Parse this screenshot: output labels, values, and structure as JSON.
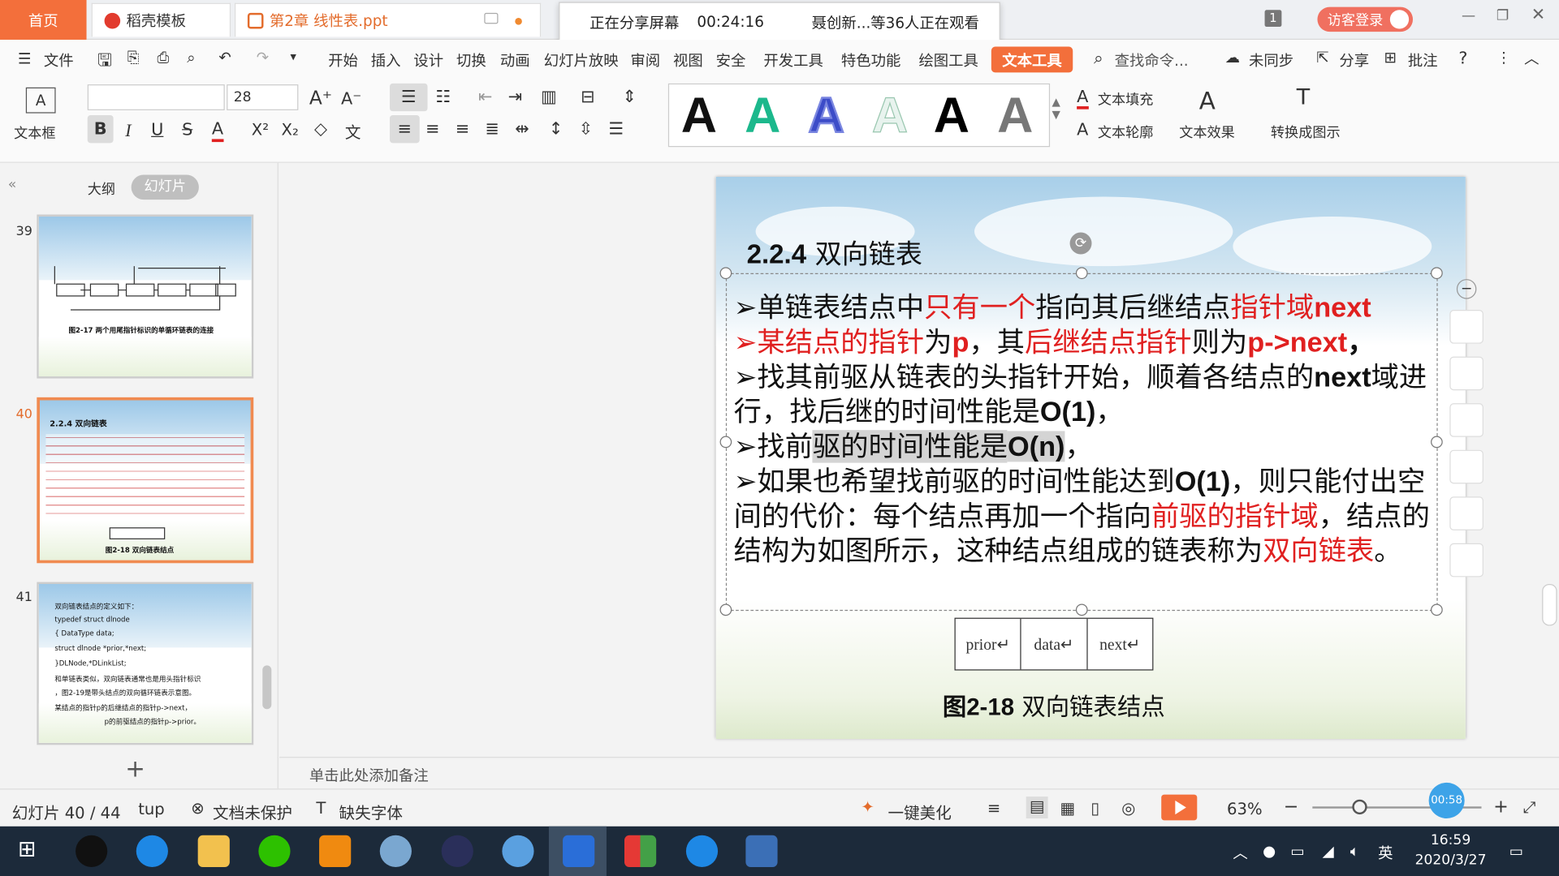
{
  "tabs": {
    "home": "首页",
    "template": "稻壳模板",
    "document": "第2章 线性表.ppt"
  },
  "share_banner": {
    "status": "正在分享屏幕",
    "time": "00:24:16",
    "viewers": "聂创新...等36人正在观看"
  },
  "titlebar": {
    "badge": "1",
    "visitor_login": "访客登录"
  },
  "menu": {
    "file": "文件",
    "items": [
      "开始",
      "插入",
      "设计",
      "切换",
      "动画",
      "幻灯片放映",
      "审阅",
      "视图",
      "安全",
      "开发工具",
      "特色功能",
      "绘图工具"
    ],
    "active": "文本工具",
    "search": "查找命令...",
    "sync": "未同步",
    "share": "分享",
    "comment": "批注"
  },
  "ribbon": {
    "textbox": "文本框",
    "font_size": "28",
    "text_fill": "文本填充",
    "text_outline": "文本轮廓",
    "text_effect": "文本效果",
    "convert": "转换成图示",
    "art_letter": "A"
  },
  "left_panel": {
    "outline_tab": "大纲",
    "slides_tab": "幻灯片",
    "slides": [
      {
        "num": "39",
        "caption": "图2-17 两个用尾指针标识的单循环链表的连接"
      },
      {
        "num": "40",
        "title": "2.2.4 双向链表",
        "caption": "图2-18 双向链表结点"
      },
      {
        "num": "41",
        "lines": [
          "双向链表结点的定义如下：",
          "typedef struct  dlnode",
          "{    DataType data;",
          "    struct dlnode *prior,*next;",
          "}DLNode,*DLinkList;",
          "    和单链表类似，双向链表通常也是用头指针标识",
          "，图2-19是带头结点的双向循环链表示意图。",
          "某结点的指针p的后继结点的指针p->next，",
          "p的前驱结点的指针p->prior。"
        ]
      }
    ]
  },
  "slide": {
    "title_num": "2.2.4",
    "title_text": " 双向链表",
    "bullet1_a": "➢单链表结点中",
    "bullet1_b": "只有一个",
    "bullet1_c": "指向其后继结点",
    "bullet1_d": "指针域",
    "bullet1_e": "next",
    "bullet2_a": "➢某结点的指针",
    "bullet2_b": "为",
    "bullet2_c": "p",
    "bullet2_d": "，其",
    "bullet2_e": "后继结点指针",
    "bullet2_f": "则为",
    "bullet2_g": "p->next",
    "bullet2_h": "，",
    "bullet3_a": "➢找其前驱从链表的头指针开始，顺着各结点的",
    "bullet3_b": "next",
    "bullet3_c": "域进行，找后继的时间性能是",
    "bullet3_d": "O(1)",
    "bullet3_e": "，",
    "bullet4_a": "➢找前",
    "bullet4_b": "驱的时间性能是",
    "bullet4_c": "O(n)",
    "bullet4_d": "，",
    "bullet5_a": "➢如果也希望找前驱的时间性能达到",
    "bullet5_b": "O(1)",
    "bullet5_c": "，则只能付出空间的代价：每个结点再加一个指向",
    "bullet5_d": "前驱的指针域",
    "bullet5_e": "，结点的结构为如图所示，这种结点组成的链表称为",
    "bullet5_f": "双向链表",
    "bullet5_g": "。",
    "node_cells": [
      "prior↵",
      "data↵",
      "next↵"
    ],
    "caption_num": "图2-18",
    "caption_text": " 双向链表结点"
  },
  "notes_placeholder": "单击此处添加备注",
  "status": {
    "slide_counter": "幻灯片 40 / 44",
    "theme": "tup",
    "protect": "文档未保护",
    "missing_font": "缺失字体",
    "beautify": "一键美化",
    "zoom": "63%",
    "timer": "00:58"
  },
  "taskbar": {
    "ime": "英",
    "time": "16:59",
    "date": "2020/3/27"
  },
  "colors": {
    "accent": "#f36f3b",
    "red_text": "#e02020"
  }
}
